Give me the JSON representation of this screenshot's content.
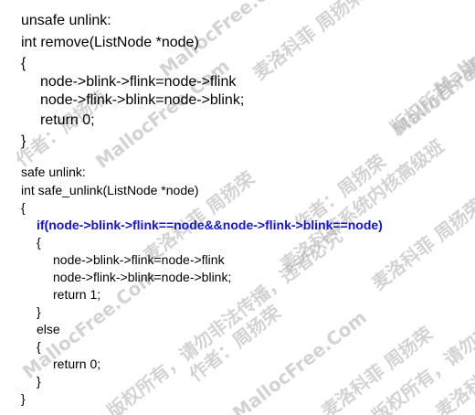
{
  "colors": {
    "highlight": "#1414d2",
    "text": "#000000",
    "watermark": "#afafaf"
  },
  "code": {
    "l1": "unsafe unlink:",
    "l2": "int remove(ListNode *node)",
    "l3": "{",
    "l4": "node->blink->flink=node->flink",
    "l5": "node->flink->blink=node->blink;",
    "l6": "return 0;",
    "l7": "}",
    "l8": "safe unlink:",
    "l9": "int safe_unlink(ListNode *node)",
    "l10": "{",
    "l11": "if(node->blink->flink==node&&node->flink->blink==node)",
    "l12": "{",
    "l13": "node->blink->flink=node->flink",
    "l14": "node->flink->blink=node->blink;",
    "l15": "return 1;",
    "l16": "}",
    "l17": "else",
    "l18": "{",
    "l19": "return 0;",
    "l20": "}",
    "l21": "}"
  },
  "watermarks": {
    "w1": "MallocFree.Com",
    "w2": "麦洛科菲 周扬荣",
    "w3": "版权所有，请勿非法传播，违者必究",
    "w4": "作者：周扬荣",
    "w5": "MallocFree.Com",
    "w6": "麦洛科菲系统内核高级班",
    "w7": "MallocFree.Com",
    "w8": "麦洛科菲 周扬荣",
    "w9": "作者：周扬荣",
    "w10": "MallocFree.Com",
    "w11": "麦洛科菲 周扬荣",
    "w12": "版权所有，请勿非法传播，违者必究",
    "w13": "作者：周扬荣",
    "w14": "MallocFree.Com",
    "w15": "麦洛科菲 周扬荣",
    "w16": "版权所有，请勿非法传播",
    "w17": "麦洛科菲 周扬荣",
    "w18": "MallocFree.Com"
  }
}
